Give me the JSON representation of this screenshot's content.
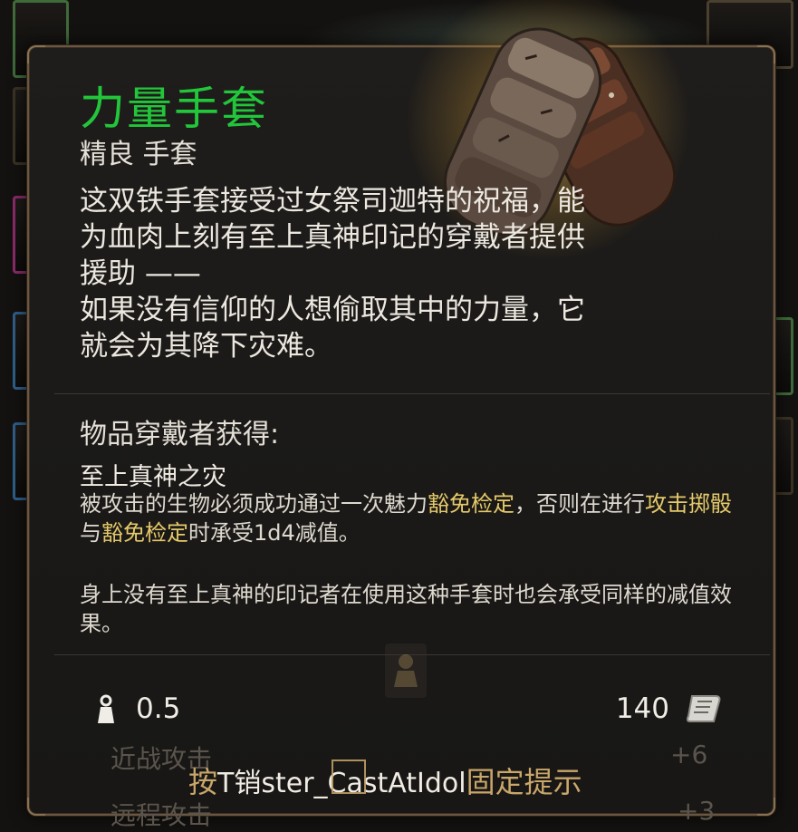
{
  "item": {
    "name": "力量手套",
    "subtitle": "精良 手套",
    "description": "这双铁手套接受过女祭司迦特的祝福，能\n为血肉上刻有至上真神印记的穿戴者提供\n援助 ——\n如果没有信仰的人想偷取其中的力量，它\n就会为其降下灾难。"
  },
  "effects": {
    "header": "物品穿戴者获得:",
    "name": "至上真神之灾",
    "desc_part1": "被攻击的生物必须成功通过一次魅力",
    "kw_save_throw_1": "豁免检定",
    "desc_part2": "，否则在进行",
    "kw_attack_roll": "攻击掷骰",
    "desc_part3": "与",
    "kw_save_throw_2": "豁免检定",
    "desc_part4": "时承受1d4减值。",
    "note": "身上没有至上真神的印记者在使用这种手套时也会承受同样的减值效果。"
  },
  "stats": {
    "weight": "0.5",
    "price": "140"
  },
  "background": {
    "row1_label": "近战攻击",
    "row1_value": "+6",
    "row2_label": "远程攻击",
    "row2_value": "+3"
  },
  "hint": {
    "prefix": "按",
    "key": "T销ster_CastAtIdol",
    "suffix": "固定提示"
  },
  "colors": {
    "name": "#22c63a",
    "keyword": "#e5c96a",
    "border": "#6b5640"
  }
}
